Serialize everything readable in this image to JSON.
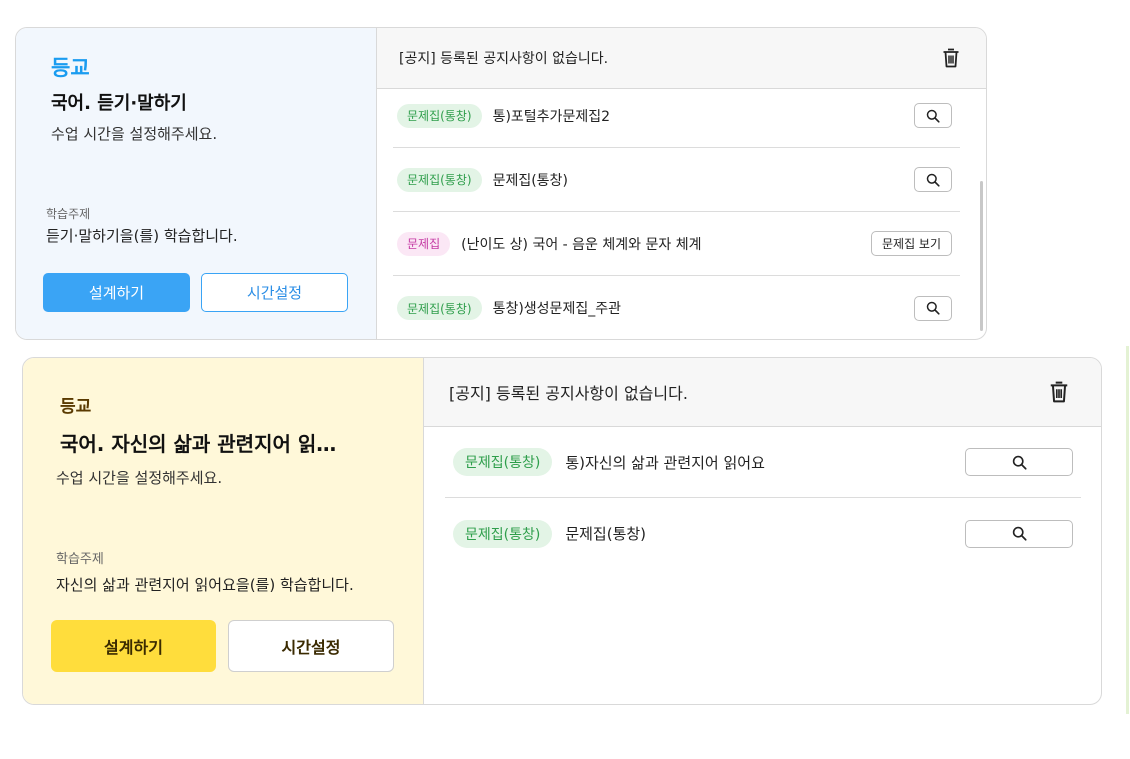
{
  "cards": [
    {
      "status": "등교",
      "subject": "국어. 듣기·말하기",
      "time_hint": "수업 시간을 설정해주세요.",
      "topic_label": "학습주제",
      "topic_desc": "듣기·말하기을(를) 학습합니다.",
      "design_button": "설계하기",
      "time_button": "시간설정",
      "notice": "[공지] 등록된 공지사항이 없습니다.",
      "items": [
        {
          "tag": "문제집(통창)",
          "title": "통)포털추가문제집2"
        },
        {
          "tag": "문제집(통창)",
          "title": "문제집(통창)"
        },
        {
          "tag": "문제집",
          "title": "(난이도 상) 국어 - 음운 체계와 문자 체계",
          "view_button": "문제집 보기"
        },
        {
          "tag": "문제집(통창)",
          "title": "통창)생성문제집_주관"
        }
      ]
    },
    {
      "status": "등교",
      "subject": "국어. 자신의 삶과 관련지어 읽…",
      "time_hint": "수업 시간을 설정해주세요.",
      "topic_label": "학습주제",
      "topic_desc": "자신의 삶과 관련지어 읽어요을(를) 학습합니다.",
      "design_button": "설계하기",
      "time_button": "시간설정",
      "notice": "[공지] 등록된 공지사항이 없습니다.",
      "items": [
        {
          "tag": "문제집(통창)",
          "title": "통)자신의 삶과 관련지어 읽어요"
        },
        {
          "tag": "문제집(통창)",
          "title": "문제집(통창)"
        }
      ]
    }
  ],
  "colors": {
    "card1_accent": "#3aa4f5",
    "card1_left_bg": "#f2f7fd",
    "card2_accent": "#ffdd3c",
    "card2_left_bg": "#fff8d9",
    "tag_green_bg": "#e3f4e6",
    "tag_green_text": "#2e9e4b",
    "tag_pink_bg": "#fbe7f5",
    "tag_pink_text": "#c43aa3"
  },
  "icons": {
    "delete": "trash-icon",
    "search": "search-icon"
  }
}
